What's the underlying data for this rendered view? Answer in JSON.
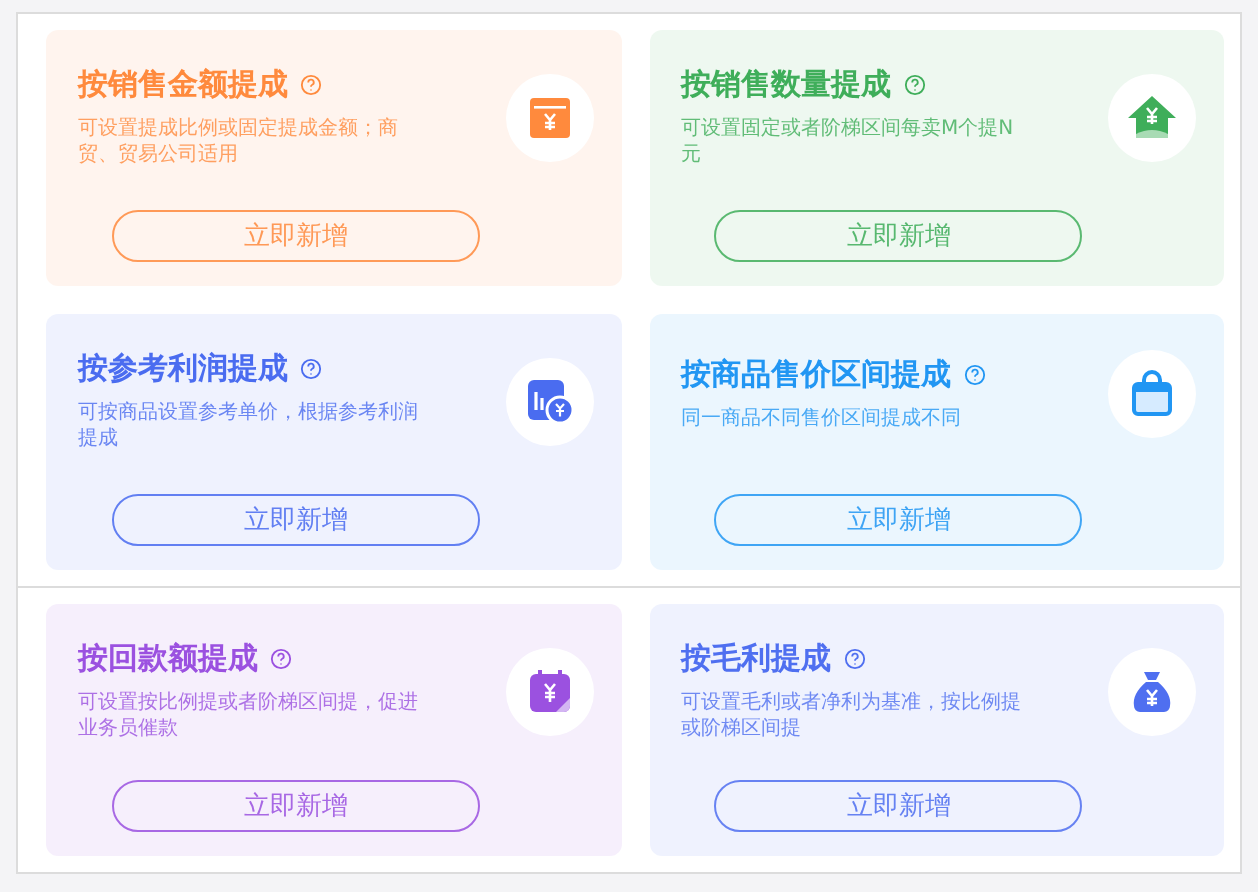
{
  "panels": [
    {
      "cards": [
        {
          "title": "按销售金额提成",
          "description": "可设置提成比例或固定提成金额；商贸、贸易公司适用",
          "button": "立即新增",
          "color": "#ff8a3d",
          "kind": "box"
        },
        {
          "title": "按销售数量提成",
          "description": "可设置固定或者阶梯区间每卖M个提N元",
          "button": "立即新增",
          "color": "#3fae5a",
          "kind": "house"
        },
        {
          "title": "按参考利润提成",
          "description": "可按商品设置参考单价，根据参考利润提成",
          "button": "立即新增",
          "color": "#4a6cf0",
          "kind": "chart"
        },
        {
          "title": "按商品售价区间提成",
          "description": "同一商品不同售价区间提成不同",
          "button": "立即新增",
          "color": "#2196f3",
          "kind": "bag"
        }
      ]
    },
    {
      "cards": [
        {
          "title": "按回款额提成",
          "description": "可设置按比例提或者阶梯区间提，促进业务员催款",
          "button": "立即新增",
          "color": "#9b51e0",
          "kind": "calendar"
        },
        {
          "title": "按毛利提成",
          "description": "可设置毛利或者净利为基准，按比例提或阶梯区间提",
          "button": "立即新增",
          "color": "#4f6ff0",
          "kind": "moneybag"
        }
      ]
    }
  ]
}
